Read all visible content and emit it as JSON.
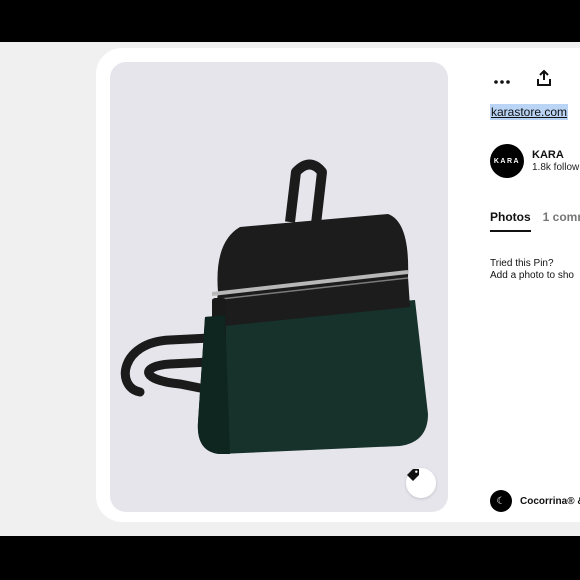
{
  "pin": {
    "image_alt": "",
    "tag_icon": "tag-icon"
  },
  "actions": {
    "more_icon": "more-icon",
    "share_icon": "share-icon"
  },
  "source": {
    "link_text": "karastore.com"
  },
  "profile": {
    "avatar_text": "KARA",
    "name": "KARA",
    "followers": "1.8k follow"
  },
  "tabs": [
    {
      "label": "Photos",
      "active": true
    },
    {
      "label": "1 comm",
      "active": false
    }
  ],
  "tried": {
    "line1": "Tried this Pin?",
    "line2": "Add a photo to sho"
  },
  "commenter": {
    "avatar_text": "☾",
    "name": "Cocorrina® &"
  },
  "colors": {
    "screen_bg": "#f0f0f0",
    "image_bg": "#e7e5ec",
    "link_highlight": "#b9d4f5",
    "suede_green": "#16322b",
    "leather_black": "#1a1a1a"
  }
}
